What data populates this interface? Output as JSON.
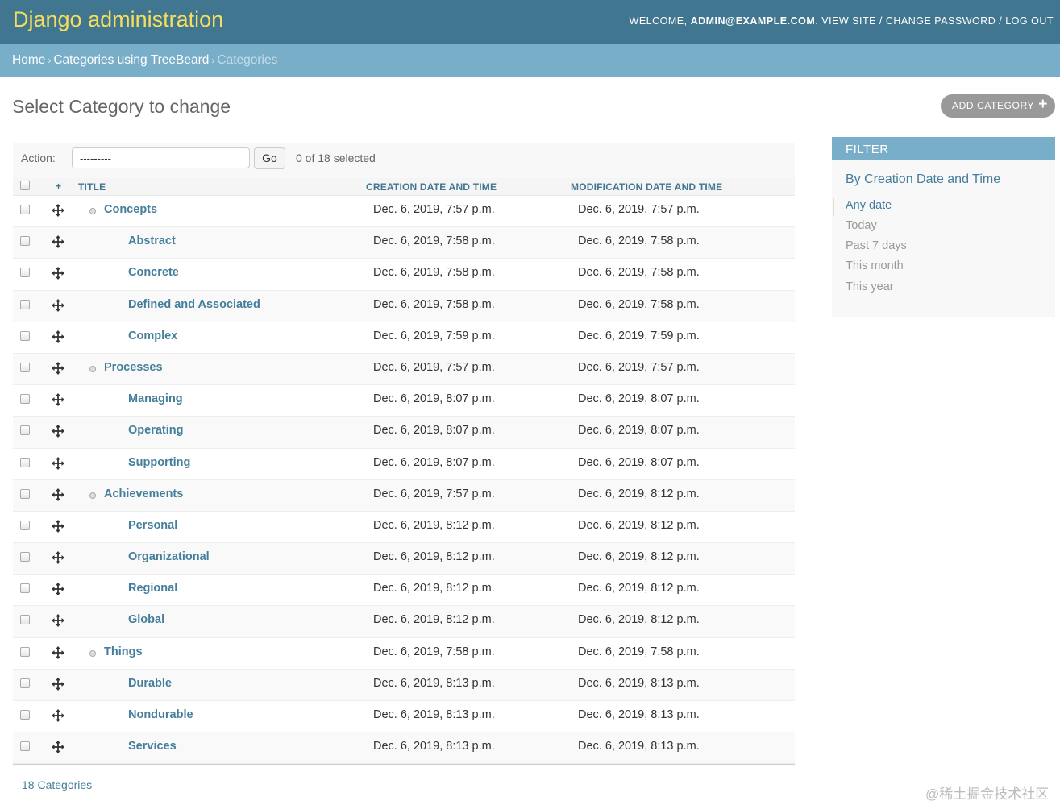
{
  "header": {
    "branding": "Django administration",
    "welcome": "WELCOME, ",
    "username": "ADMIN@EXAMPLE.COM",
    "view_site": "VIEW SITE",
    "change_password": "CHANGE PASSWORD",
    "log_out": "LOG OUT"
  },
  "breadcrumbs": {
    "home": "Home",
    "app": "Categories using TreeBeard",
    "current": "Categories",
    "separator": "›"
  },
  "page": {
    "title": "Select Category to change",
    "add_button": "ADD CATEGORY",
    "add_icon": "+"
  },
  "actions": {
    "label": "Action:",
    "selected_value": "---------",
    "go": "Go",
    "counter": "0 of 18 selected"
  },
  "table": {
    "headers": {
      "add": "+",
      "title": "TITLE",
      "created": "CREATION DATE AND TIME",
      "modified": "MODIFICATION DATE AND TIME"
    },
    "rows": [
      {
        "title": "Concepts",
        "level": 1,
        "created": "Dec. 6, 2019, 7:57 p.m.",
        "modified": "Dec. 6, 2019, 7:57 p.m."
      },
      {
        "title": "Abstract",
        "level": 2,
        "created": "Dec. 6, 2019, 7:58 p.m.",
        "modified": "Dec. 6, 2019, 7:58 p.m."
      },
      {
        "title": "Concrete",
        "level": 2,
        "created": "Dec. 6, 2019, 7:58 p.m.",
        "modified": "Dec. 6, 2019, 7:58 p.m."
      },
      {
        "title": "Defined and Associated",
        "level": 2,
        "created": "Dec. 6, 2019, 7:58 p.m.",
        "modified": "Dec. 6, 2019, 7:58 p.m."
      },
      {
        "title": "Complex",
        "level": 2,
        "created": "Dec. 6, 2019, 7:59 p.m.",
        "modified": "Dec. 6, 2019, 7:59 p.m."
      },
      {
        "title": "Processes",
        "level": 1,
        "created": "Dec. 6, 2019, 7:57 p.m.",
        "modified": "Dec. 6, 2019, 7:57 p.m."
      },
      {
        "title": "Managing",
        "level": 2,
        "created": "Dec. 6, 2019, 8:07 p.m.",
        "modified": "Dec. 6, 2019, 8:07 p.m."
      },
      {
        "title": "Operating",
        "level": 2,
        "created": "Dec. 6, 2019, 8:07 p.m.",
        "modified": "Dec. 6, 2019, 8:07 p.m."
      },
      {
        "title": "Supporting",
        "level": 2,
        "created": "Dec. 6, 2019, 8:07 p.m.",
        "modified": "Dec. 6, 2019, 8:07 p.m."
      },
      {
        "title": "Achievements",
        "level": 1,
        "created": "Dec. 6, 2019, 7:57 p.m.",
        "modified": "Dec. 6, 2019, 8:12 p.m."
      },
      {
        "title": "Personal",
        "level": 2,
        "created": "Dec. 6, 2019, 8:12 p.m.",
        "modified": "Dec. 6, 2019, 8:12 p.m."
      },
      {
        "title": "Organizational",
        "level": 2,
        "created": "Dec. 6, 2019, 8:12 p.m.",
        "modified": "Dec. 6, 2019, 8:12 p.m."
      },
      {
        "title": "Regional",
        "level": 2,
        "created": "Dec. 6, 2019, 8:12 p.m.",
        "modified": "Dec. 6, 2019, 8:12 p.m."
      },
      {
        "title": "Global",
        "level": 2,
        "created": "Dec. 6, 2019, 8:12 p.m.",
        "modified": "Dec. 6, 2019, 8:12 p.m."
      },
      {
        "title": "Things",
        "level": 1,
        "created": "Dec. 6, 2019, 7:58 p.m.",
        "modified": "Dec. 6, 2019, 7:58 p.m."
      },
      {
        "title": "Durable",
        "level": 2,
        "created": "Dec. 6, 2019, 8:13 p.m.",
        "modified": "Dec. 6, 2019, 8:13 p.m."
      },
      {
        "title": "Nondurable",
        "level": 2,
        "created": "Dec. 6, 2019, 8:13 p.m.",
        "modified": "Dec. 6, 2019, 8:13 p.m."
      },
      {
        "title": "Services",
        "level": 2,
        "created": "Dec. 6, 2019, 8:13 p.m.",
        "modified": "Dec. 6, 2019, 8:13 p.m."
      }
    ]
  },
  "paginator": "18 Categories",
  "filter": {
    "title": "FILTER",
    "heading": "By Creation Date and Time",
    "options": [
      {
        "label": "Any date",
        "selected": true
      },
      {
        "label": "Today",
        "selected": false
      },
      {
        "label": "Past 7 days",
        "selected": false
      },
      {
        "label": "This month",
        "selected": false
      },
      {
        "label": "This year",
        "selected": false
      }
    ]
  },
  "watermark": "@稀土掘金技术社区",
  "icons": {
    "row_move": "move-arrows-icon",
    "node_toggle": "tree-node-icon",
    "add": "plus-icon"
  },
  "colors": {
    "header_bg": "#417690",
    "branding": "#f5dd5d",
    "breadcrumb_bg": "#79aec8",
    "link": "#447e9b",
    "button_gray": "#999999"
  }
}
